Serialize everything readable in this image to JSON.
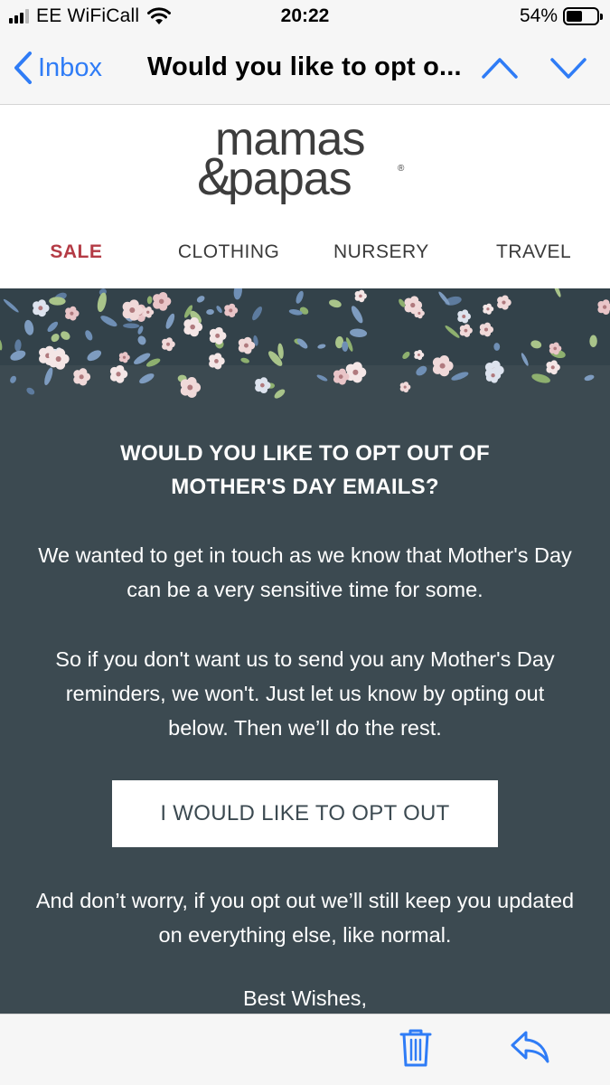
{
  "status_bar": {
    "carrier": "EE WiFiCall",
    "time": "20:22",
    "battery_percent": "54%",
    "battery_level": 0.54,
    "icons": [
      "signal-icon",
      "wifi-icon",
      "battery-icon"
    ]
  },
  "nav": {
    "back_label": "Inbox",
    "title": "Would you like to opt o...",
    "accent_color": "#2f7cf6",
    "icons": [
      "chevron-left-icon",
      "chevron-up-icon",
      "chevron-down-icon"
    ]
  },
  "email": {
    "brand": {
      "line1": "mamas",
      "line2": "papas",
      "ampersand": "&",
      "registered": "®"
    },
    "menu": [
      {
        "label": "SALE"
      },
      {
        "label": "CLOTHING"
      },
      {
        "label": "NURSERY"
      },
      {
        "label": "TRAVEL"
      }
    ],
    "headline_line1": "WOULD YOU LIKE TO OPT OUT OF",
    "headline_line2": "MOTHER'S DAY EMAILS?",
    "para1_line1": "We wanted to get in touch as we know that Mother's Day",
    "para1_line2": "can be a very sensitive time for some.",
    "para2_line1": "So if you don't want us to send you any Mother's Day",
    "para2_line2": "reminders, we won't. Just let us know by opting out",
    "para2_line3": "below. Then we’ll do the rest.",
    "button_label": "I WOULD LIKE TO OPT OUT",
    "para3_line1": "And don’t worry, if you opt out we’ll still keep you updated",
    "para3_line2": "on everything else, like normal.",
    "signoff": "Best Wishes,",
    "colors": {
      "panel": "#3c4a51",
      "sale": "#b43b45"
    }
  },
  "toolbar": {
    "icons": [
      "trash-icon",
      "reply-icon"
    ]
  }
}
